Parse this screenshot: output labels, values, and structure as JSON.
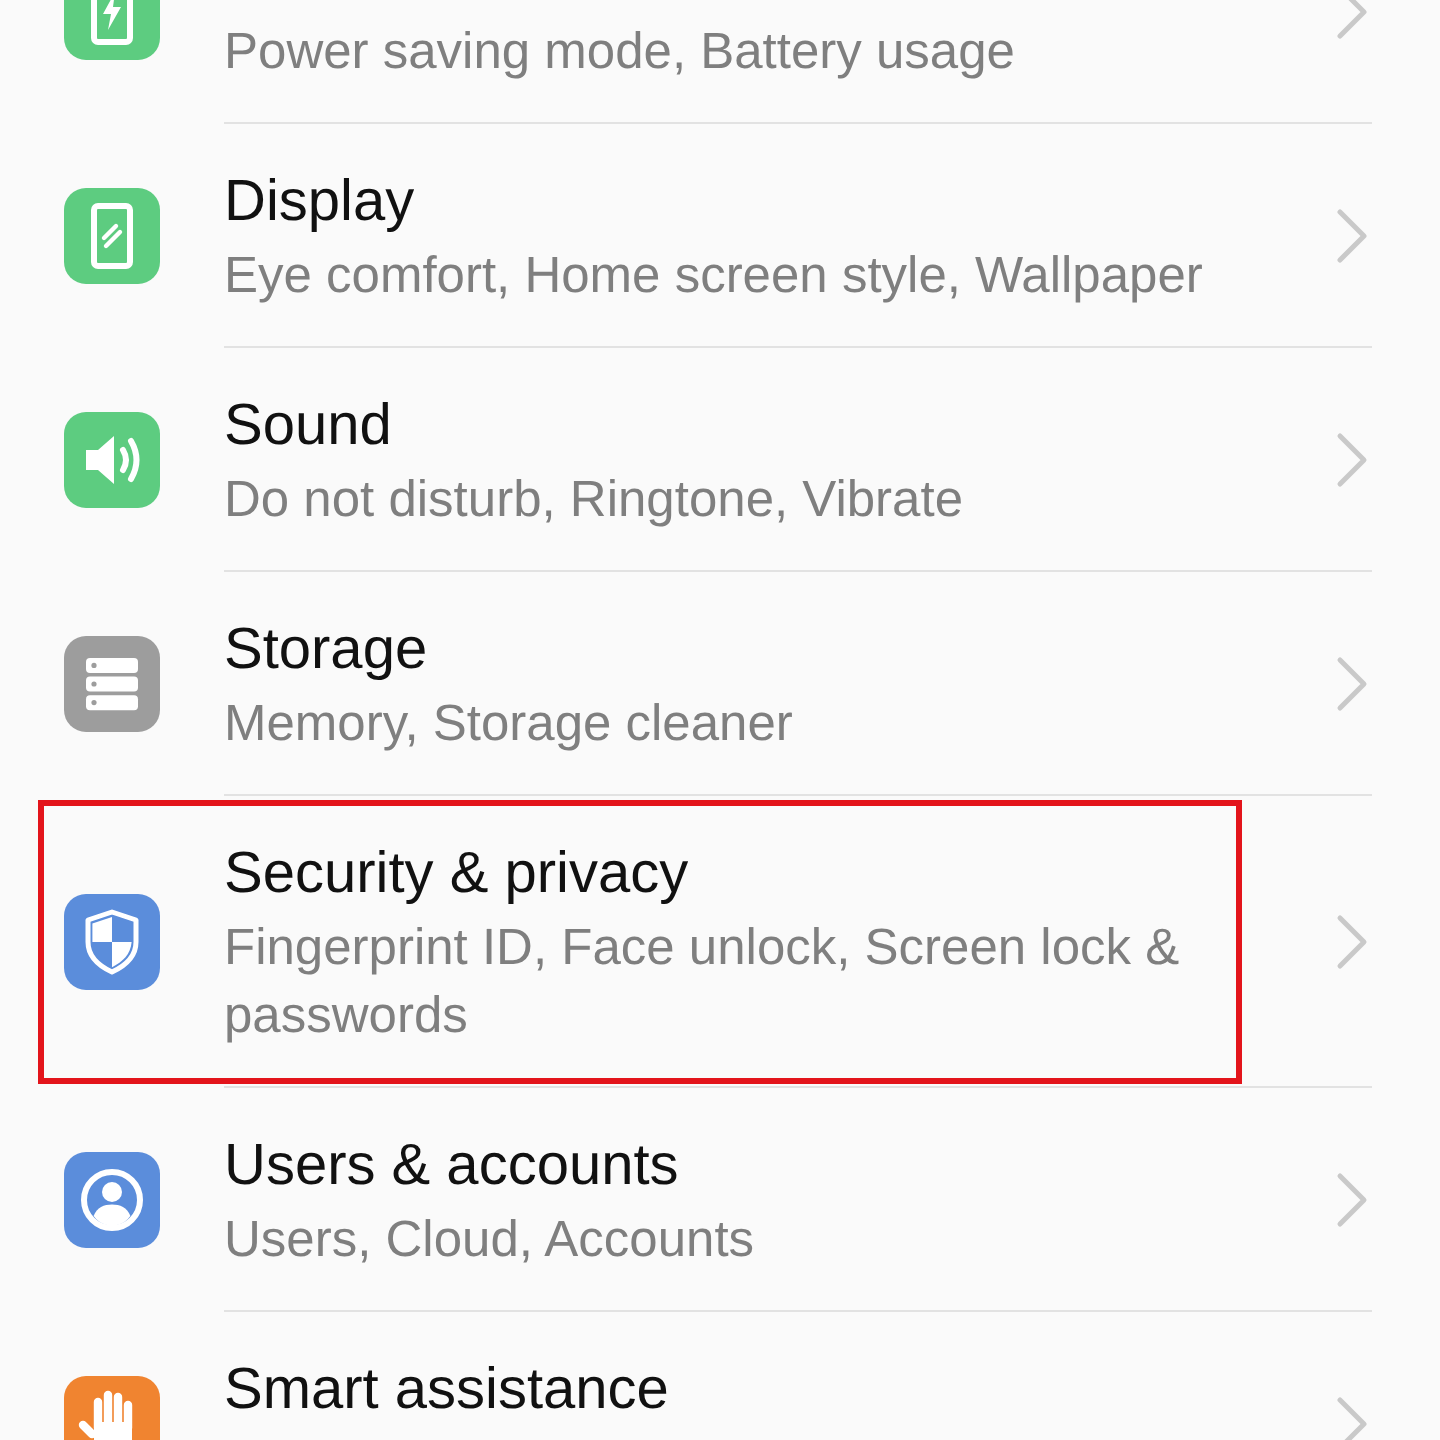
{
  "items": [
    {
      "subtitle": "Power saving mode, Battery usage",
      "highlighted": false
    },
    {
      "title": "Display",
      "subtitle": "Eye comfort, Home screen style, Wallpaper",
      "highlighted": false
    },
    {
      "title": "Sound",
      "subtitle": "Do not disturb, Ringtone, Vibrate",
      "highlighted": false
    },
    {
      "title": "Storage",
      "subtitle": "Memory, Storage cleaner",
      "highlighted": false
    },
    {
      "title": "Security & privacy",
      "subtitle": "Fingerprint ID, Face unlock, Screen lock & passwords",
      "highlighted": true
    },
    {
      "title": "Users & accounts",
      "subtitle": "Users, Cloud, Accounts",
      "highlighted": false
    },
    {
      "title": "Smart assistance",
      "highlighted": false
    }
  ]
}
